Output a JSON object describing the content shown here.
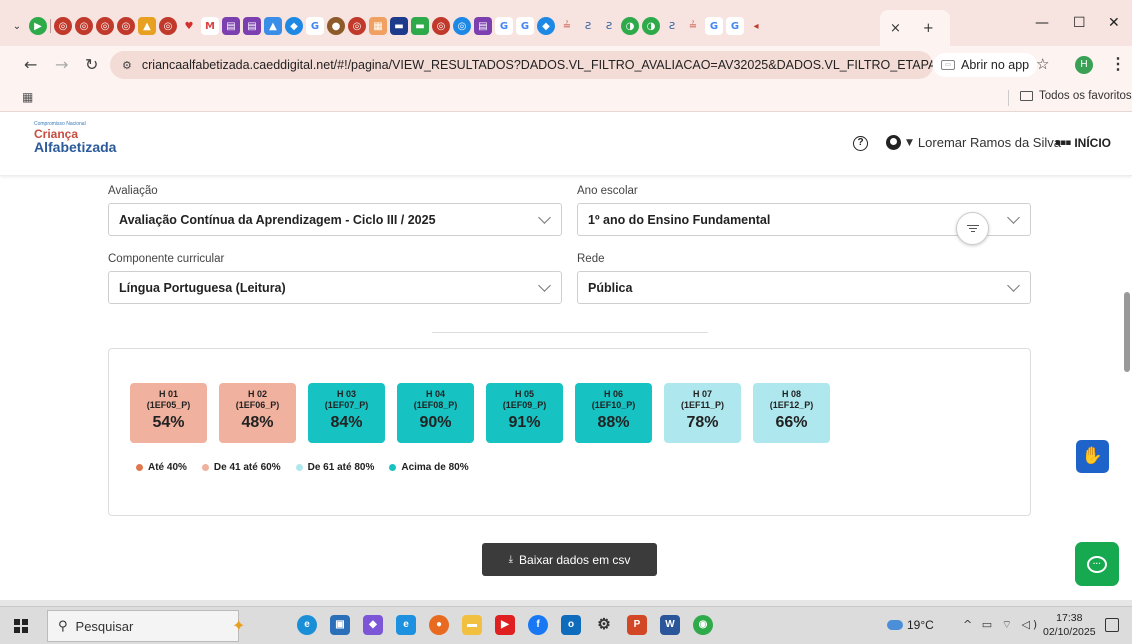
{
  "browser": {
    "active_tab_close": "×",
    "new_tab": "+",
    "url": "criancaalfabetizada.caeddigital.net/#!/pagina/VIEW_RESULTADOS?DADOS.VL_FILTRO_AVALIACAO=AV32025&DADOS.VL_FILTRO_ETAPA=ENSINO%20F...",
    "open_app_label": "Abrir no app",
    "profile_initial": "H",
    "all_favorites": "Todos os favoritos"
  },
  "header": {
    "logo_small": "Compromisso Nacional",
    "logo_line1": "Criança",
    "logo_line2": "Alfabetizada",
    "user_name": "Loremar Ramos da Silva",
    "home_label": "INÍCIO"
  },
  "filters": {
    "avaliacao_label": "Avaliação",
    "avaliacao_value": "Avaliação Contínua da Aprendizagem - Ciclo III / 2025",
    "ano_label": "Ano escolar",
    "ano_value": "1º ano do Ensino Fundamental",
    "componente_label": "Componente curricular",
    "componente_value": "Língua Portuguesa (Leitura)",
    "rede_label": "Rede",
    "rede_value": "Pública"
  },
  "skills": [
    {
      "code": "H 01",
      "desc": "(1EF05_P)",
      "pct": "54%",
      "color": "#f0b19e"
    },
    {
      "code": "H 02",
      "desc": "(1EF06_P)",
      "pct": "48%",
      "color": "#f0b19e"
    },
    {
      "code": "H 03",
      "desc": "(1EF07_P)",
      "pct": "84%",
      "color": "#16c2c2"
    },
    {
      "code": "H 04",
      "desc": "(1EF08_P)",
      "pct": "90%",
      "color": "#16c2c2"
    },
    {
      "code": "H 05",
      "desc": "(1EF09_P)",
      "pct": "91%",
      "color": "#16c2c2"
    },
    {
      "code": "H 06",
      "desc": "(1EF10_P)",
      "pct": "88%",
      "color": "#16c2c2"
    },
    {
      "code": "H 07",
      "desc": "(1EF11_P)",
      "pct": "78%",
      "color": "#aee8ee"
    },
    {
      "code": "H 08",
      "desc": "(1EF12_P)",
      "pct": "66%",
      "color": "#aee8ee"
    }
  ],
  "legend": [
    {
      "label": "Até 40%",
      "color": "#e0784e"
    },
    {
      "label": "De 41 até 60%",
      "color": "#f0b19e"
    },
    {
      "label": "De 61 até 80%",
      "color": "#aee8ee"
    },
    {
      "label": "Acima de 80%",
      "color": "#16c2c2"
    }
  ],
  "download_label": "Baixar dados em csv",
  "taskbar": {
    "search_placeholder": "Pesquisar",
    "temperature": "19°C",
    "time": "17:38",
    "date": "02/10/2025"
  }
}
